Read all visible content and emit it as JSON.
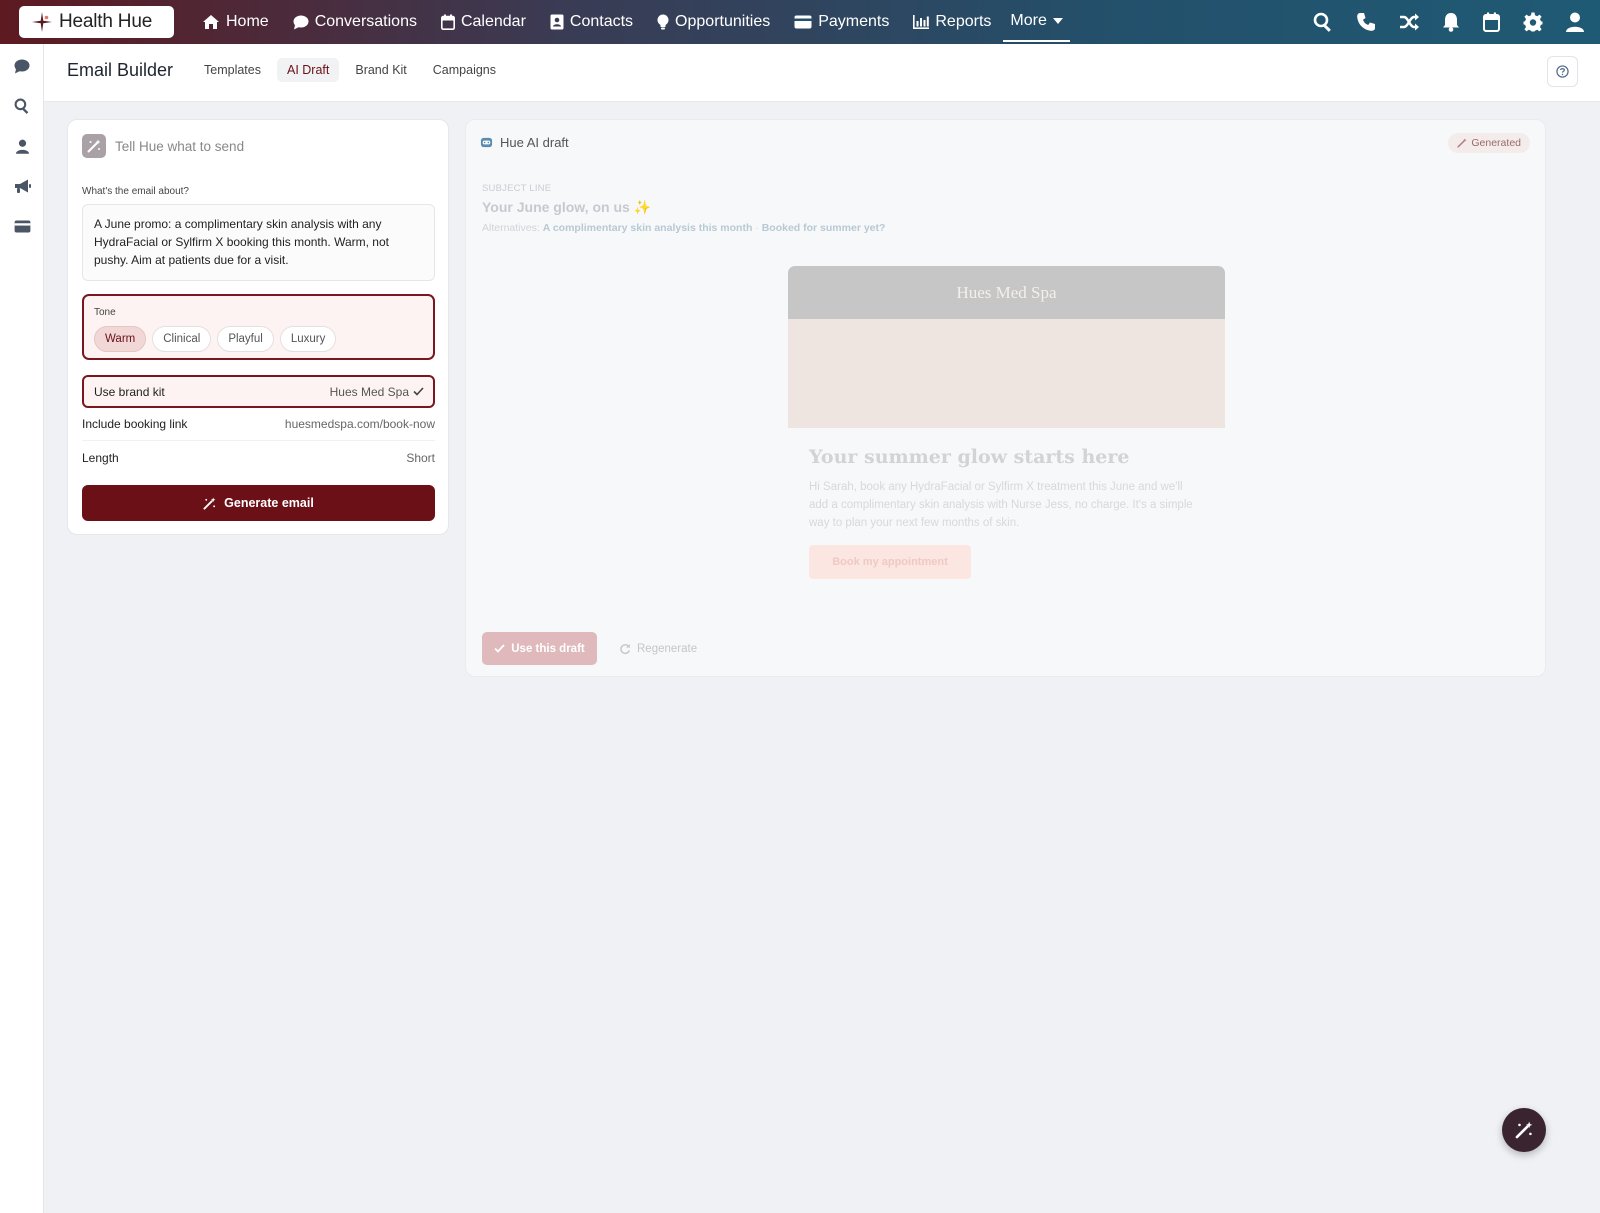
{
  "app": {
    "logo_text": "Health Hue"
  },
  "topnav": {
    "items": [
      {
        "label": "Home",
        "icon": "home-icon"
      },
      {
        "label": "Conversations",
        "icon": "chat-icon"
      },
      {
        "label": "Calendar",
        "icon": "calendar-icon"
      },
      {
        "label": "Contacts",
        "icon": "contact-card-icon"
      },
      {
        "label": "Opportunities",
        "icon": "lightbulb-icon"
      },
      {
        "label": "Payments",
        "icon": "credit-card-icon"
      },
      {
        "label": "Reports",
        "icon": "bar-chart-icon"
      }
    ],
    "more_label": "More",
    "right_icons": [
      "search-icon",
      "phone-icon",
      "shuffle-icon",
      "bell-icon",
      "calendar-icon",
      "gear-icon",
      "user-icon"
    ]
  },
  "rail": {
    "icons": [
      "chat-icon",
      "search-icon",
      "user-icon",
      "megaphone-icon",
      "credit-card-icon"
    ]
  },
  "header": {
    "title": "Email Builder",
    "tabs": [
      {
        "label": "Templates",
        "active": false
      },
      {
        "label": "AI Draft",
        "active": true
      },
      {
        "label": "Brand Kit",
        "active": false
      },
      {
        "label": "Campaigns",
        "active": false
      }
    ]
  },
  "composer": {
    "prompt_label": "Tell Hue what to send",
    "about_label": "What's the email about?",
    "about_text": "A June promo: a complimentary skin analysis with any HydraFacial or Sylfirm X booking this month. Warm, not pushy. Aim at patients due for a visit.",
    "tone_label": "Tone",
    "tones": [
      {
        "label": "Warm",
        "active": true
      },
      {
        "label": "Clinical",
        "active": false
      },
      {
        "label": "Playful",
        "active": false
      },
      {
        "label": "Luxury",
        "active": false
      }
    ],
    "brand_kit_label": "Use brand kit",
    "brand_kit_value": "Hues Med Spa",
    "booking_label": "Include booking link",
    "booking_value": "huesmedspa.com/book-now",
    "length_label": "Length",
    "length_value": "Short",
    "generate_label": "Generate email"
  },
  "draft": {
    "title": "Hue AI draft",
    "badge": "Generated",
    "subject_label": "SUBJECT LINE",
    "subject": "Your June glow, on us ✨",
    "alternatives_label": "Alternatives:",
    "alternatives": [
      "A complimentary skin analysis this month",
      "Booked for summer yet?"
    ],
    "email": {
      "brand": "Hues Med Spa",
      "heading": "Your summer glow starts here",
      "body": "Hi Sarah, book any HydraFacial or Sylfirm X treatment this June and we'll add a complimentary skin analysis with Nurse Jess, no charge. It's a simple way to plan your next few months of skin.",
      "cta": "Book my appointment"
    },
    "use_label": "Use this draft",
    "regenerate_label": "Regenerate"
  },
  "colors": {
    "brand": "#6c1018",
    "accent_border": "#7a1620",
    "tone_bg": "#fdf3f2"
  }
}
